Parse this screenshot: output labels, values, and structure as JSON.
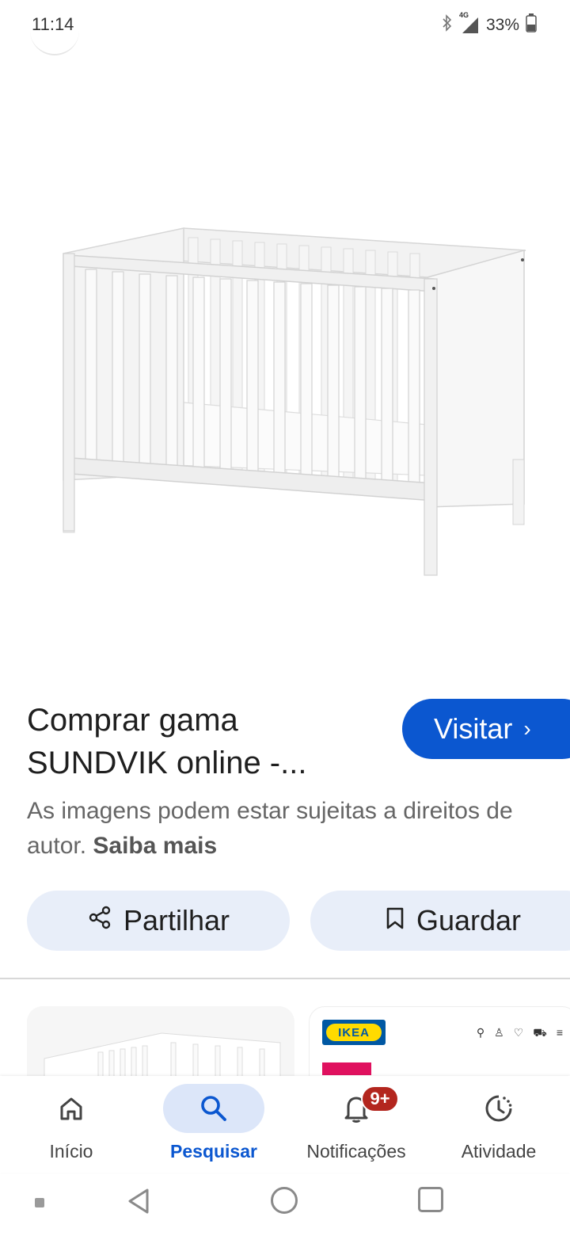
{
  "status_bar": {
    "time": "11:14",
    "network": "4G",
    "battery": "33%"
  },
  "result": {
    "title_line1": "Comprar gama",
    "title_line2": "SUNDVIK online -...",
    "visit_label": "Visitar",
    "copyright_text": "As imagens podem estar sujeitas a direitos de autor.",
    "learn_more": "Saiba mais"
  },
  "actions": {
    "share_label": "Partilhar",
    "save_label": "Guardar"
  },
  "related": {
    "logo_text": "IKEA"
  },
  "bottom_nav": {
    "items": [
      {
        "label": "Início",
        "icon": "home-icon"
      },
      {
        "label": "Pesquisar",
        "icon": "search-icon"
      },
      {
        "label": "Notificações",
        "icon": "bell-icon",
        "badge": "9+"
      },
      {
        "label": "Atividade",
        "icon": "activity-icon"
      }
    ],
    "active_color": "#0b57d0"
  },
  "colors": {
    "primary": "#0b57d0",
    "pill_bg": "#e8eef9",
    "badge": "#b3261e"
  }
}
